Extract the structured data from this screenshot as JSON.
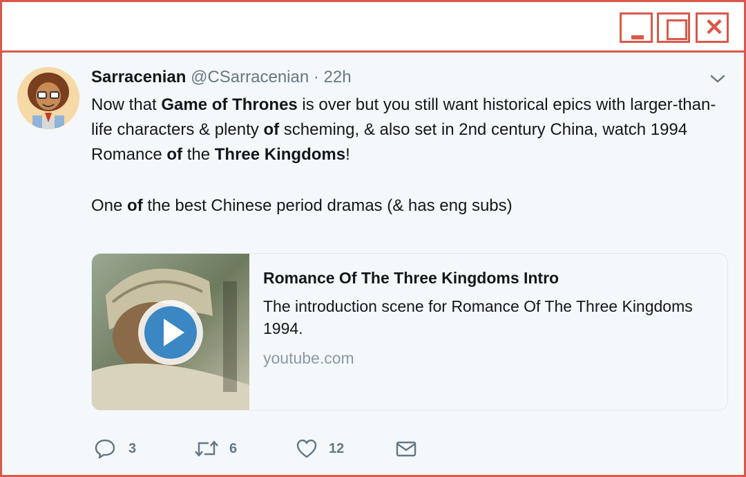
{
  "tweet": {
    "name": "Sarracenian",
    "handle": "@CSarracenian",
    "separator": "·",
    "time": "22h",
    "text_p1_a": "Now that ",
    "text_p1_b": "Game of Thrones",
    "text_p1_c": " is over but you still want historical epics with larger-than-life characters & plenty ",
    "text_p1_d": "of",
    "text_p1_e": " scheming, & also set in 2nd century China, watch 1994 Romance ",
    "text_p1_f": "of",
    "text_p1_g": " the ",
    "text_p1_h": "Three Kingdoms",
    "text_p1_i": "!",
    "text_p2_a": "One ",
    "text_p2_b": "of",
    "text_p2_c": " the best Chinese period dramas (& has eng subs)"
  },
  "card": {
    "title": "Romance Of The Three Kingdoms Intro",
    "description": "The introduction scene for Romance Of The Three Kingdoms 1994.",
    "domain": "youtube.com"
  },
  "actions": {
    "reply_count": "3",
    "retweet_count": "6",
    "like_count": "12"
  },
  "colors": {
    "window_border": "#d9584a",
    "background": "#f5f8fa",
    "secondary_text": "#657786",
    "play_button": "#3b87c4"
  },
  "icons": {
    "minimize": "minimize-icon",
    "maximize": "maximize-icon",
    "close": "close-icon",
    "caret": "chevron-down-icon",
    "reply": "reply-icon",
    "retweet": "retweet-icon",
    "like": "heart-icon",
    "message": "envelope-icon",
    "play": "play-icon"
  }
}
